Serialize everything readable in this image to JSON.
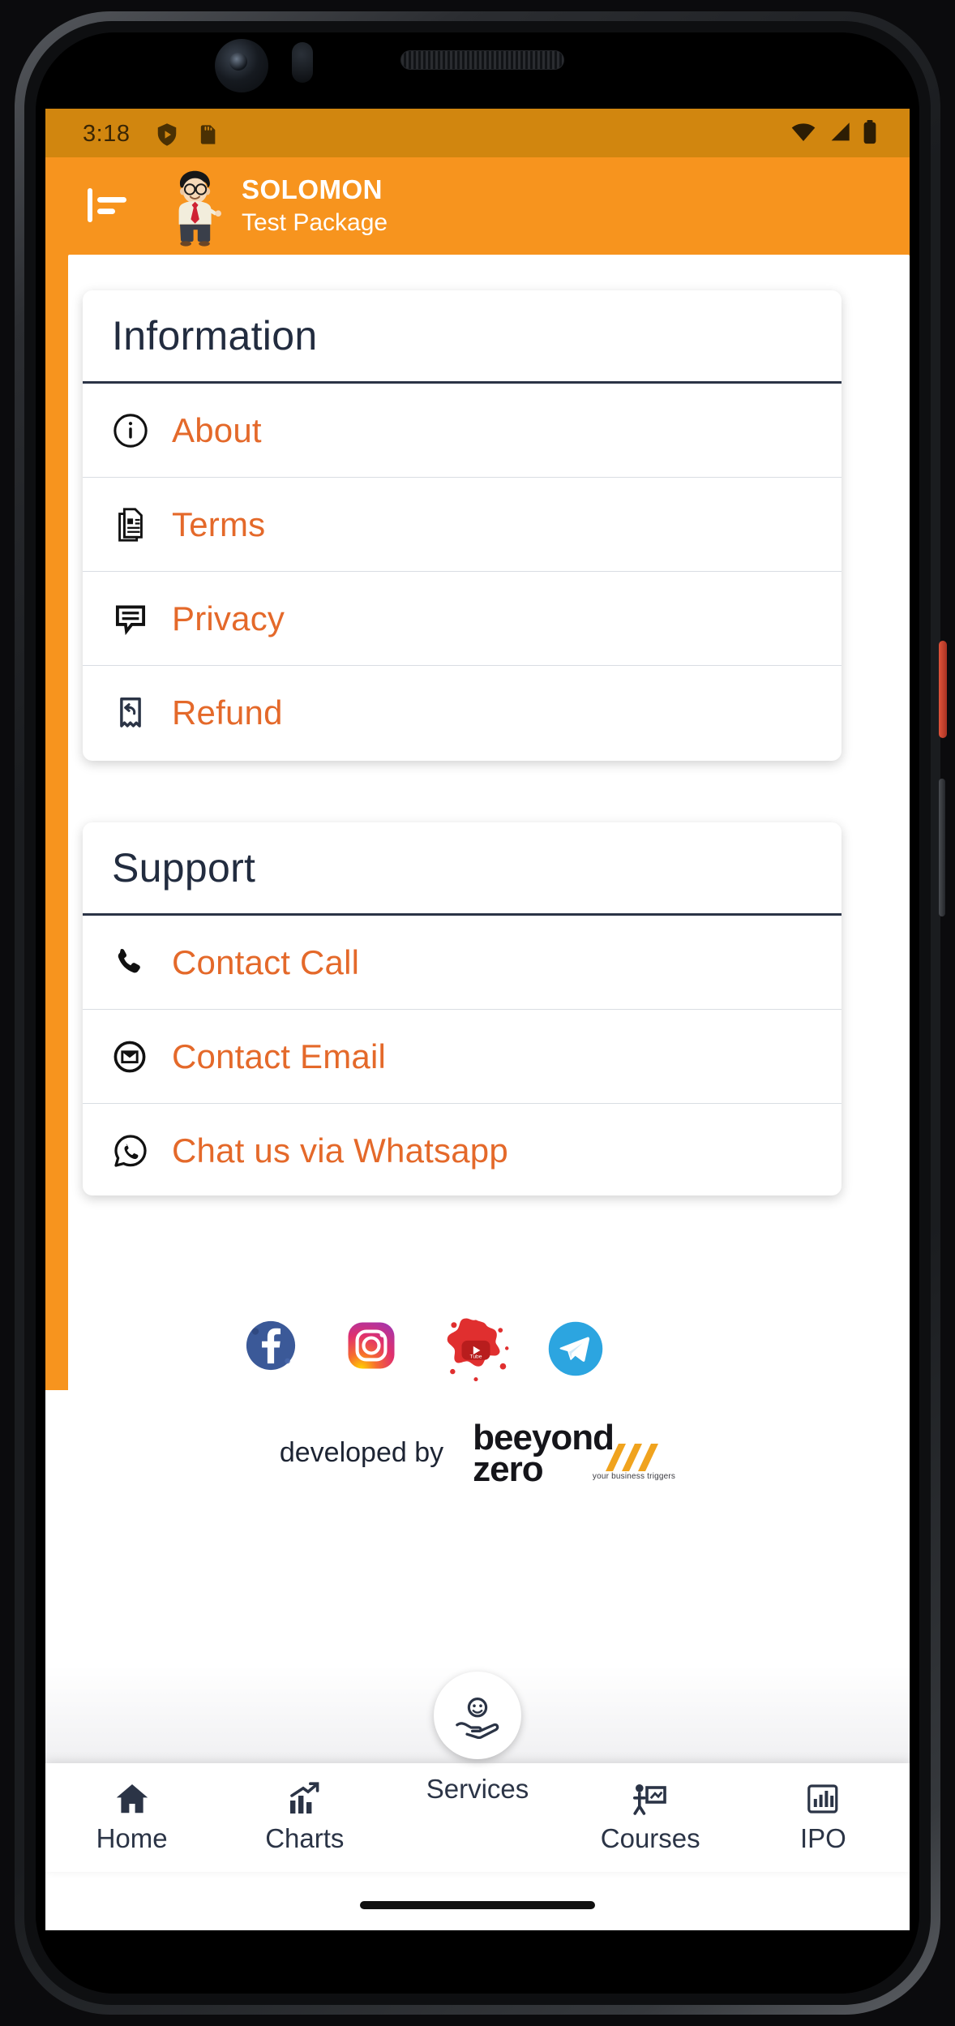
{
  "status_bar": {
    "time": "3:18",
    "left_icons": [
      "play-protect-shield-icon",
      "sd-card-icon"
    ],
    "right_icons": [
      "wifi-icon",
      "cellular-signal-icon",
      "battery-icon"
    ],
    "background_color": "#d1860f"
  },
  "app_bar": {
    "menu_icon": "hamburger-menu-icon",
    "logo": "mascot-avatar",
    "title": "SOLOMON",
    "subtitle": "Test Package",
    "background_color": "#F7941E"
  },
  "information_card": {
    "heading": "Information",
    "items": [
      {
        "label": "About",
        "icon": "info-circle-icon"
      },
      {
        "label": "Terms",
        "icon": "document-pages-icon"
      },
      {
        "label": "Privacy",
        "icon": "comment-lines-icon"
      },
      {
        "label": "Refund",
        "icon": "bookmark-undo-icon"
      }
    ]
  },
  "support_card": {
    "heading": "Support",
    "items": [
      {
        "label": "Contact Call",
        "icon": "phone-icon"
      },
      {
        "label": "Contact Email",
        "icon": "email-circle-icon"
      },
      {
        "label": "Chat us via Whatsapp",
        "icon": "whatsapp-icon"
      }
    ]
  },
  "social_links": [
    {
      "name": "facebook-icon",
      "color": "#3b5998"
    },
    {
      "name": "instagram-icon",
      "color": "#e1306c"
    },
    {
      "name": "youtube-icon",
      "color": "#e02f2f"
    },
    {
      "name": "telegram-icon",
      "color": "#2ca5e0"
    }
  ],
  "footer": {
    "developed_by_text": "developed by",
    "brand_line1": "beeyond",
    "brand_line2": "zero",
    "brand_tagline": "your business triggers"
  },
  "bottom_nav": {
    "items": [
      {
        "label": "Home",
        "icon": "home-icon"
      },
      {
        "label": "Charts",
        "icon": "chart-growth-icon"
      },
      {
        "label": "Services",
        "icon": "services-hand-icon"
      },
      {
        "label": "Courses",
        "icon": "presentation-board-icon"
      },
      {
        "label": "IPO",
        "icon": "bar-chart-icon"
      }
    ]
  },
  "theme": {
    "orange": "#F7941E",
    "link_orange": "#e4692a",
    "navy": "#222c3f"
  }
}
